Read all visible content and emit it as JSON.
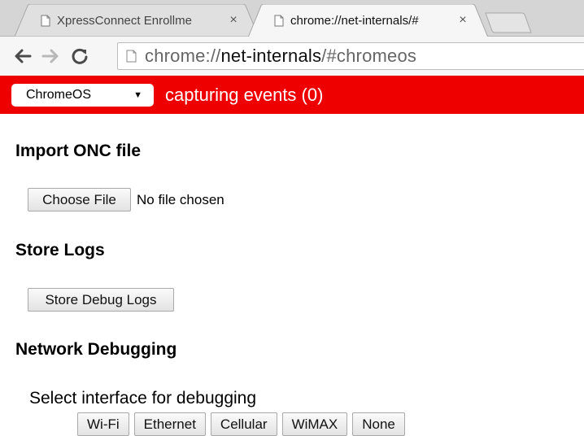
{
  "tabs": [
    {
      "title": "XpressConnect Enrollme",
      "close": "×",
      "active": false
    },
    {
      "title": "chrome://net-internals/#",
      "close": "×",
      "active": true
    }
  ],
  "toolbar": {
    "url_scheme": "chrome://",
    "url_host": "net-internals",
    "url_path": "/#chromeos"
  },
  "statusbar": {
    "selected_view": "ChromeOS",
    "capturing_text": "capturing events (0)",
    "background_color": "#ee0000"
  },
  "sections": {
    "import": {
      "heading": "Import ONC file",
      "button_label": "Choose File",
      "status": "No file chosen"
    },
    "logs": {
      "heading": "Store Logs",
      "button_label": "Store Debug Logs"
    },
    "debug": {
      "heading": "Network Debugging",
      "label": "Select interface for debugging",
      "buttons": [
        "Wi-Fi",
        "Ethernet",
        "Cellular",
        "WiMAX",
        "None"
      ]
    }
  },
  "icons": {
    "tab_favicon": "page-icon",
    "back": "back-arrow-icon",
    "forward": "forward-arrow-icon",
    "reload": "reload-icon",
    "omnibox": "page-icon",
    "dropdown": "caret-down-icon"
  }
}
